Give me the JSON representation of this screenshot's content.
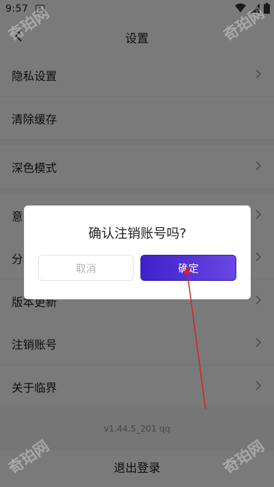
{
  "status_bar": {
    "time": "9:57",
    "notification_glyph": "A"
  },
  "header": {
    "title": "设置"
  },
  "menu": {
    "items": [
      {
        "label": "隐私设置"
      },
      {
        "label": "清除缓存"
      },
      {
        "label": "深色模式"
      },
      {
        "label": "意见反馈"
      },
      {
        "label": "分享好友"
      },
      {
        "label": "版本更新"
      },
      {
        "label": "注销账号"
      },
      {
        "label": "关于临界"
      }
    ]
  },
  "version": "v1.44.5_201 qq",
  "logout_label": "退出登录",
  "dialog": {
    "title": "确认注销账号吗?",
    "cancel_label": "取消",
    "confirm_label": "确定"
  },
  "watermark": "奇珀网",
  "colors": {
    "confirm_start": "#3d21c9",
    "confirm_end": "#6a47e4",
    "annotation_arrow": "#e02020"
  }
}
